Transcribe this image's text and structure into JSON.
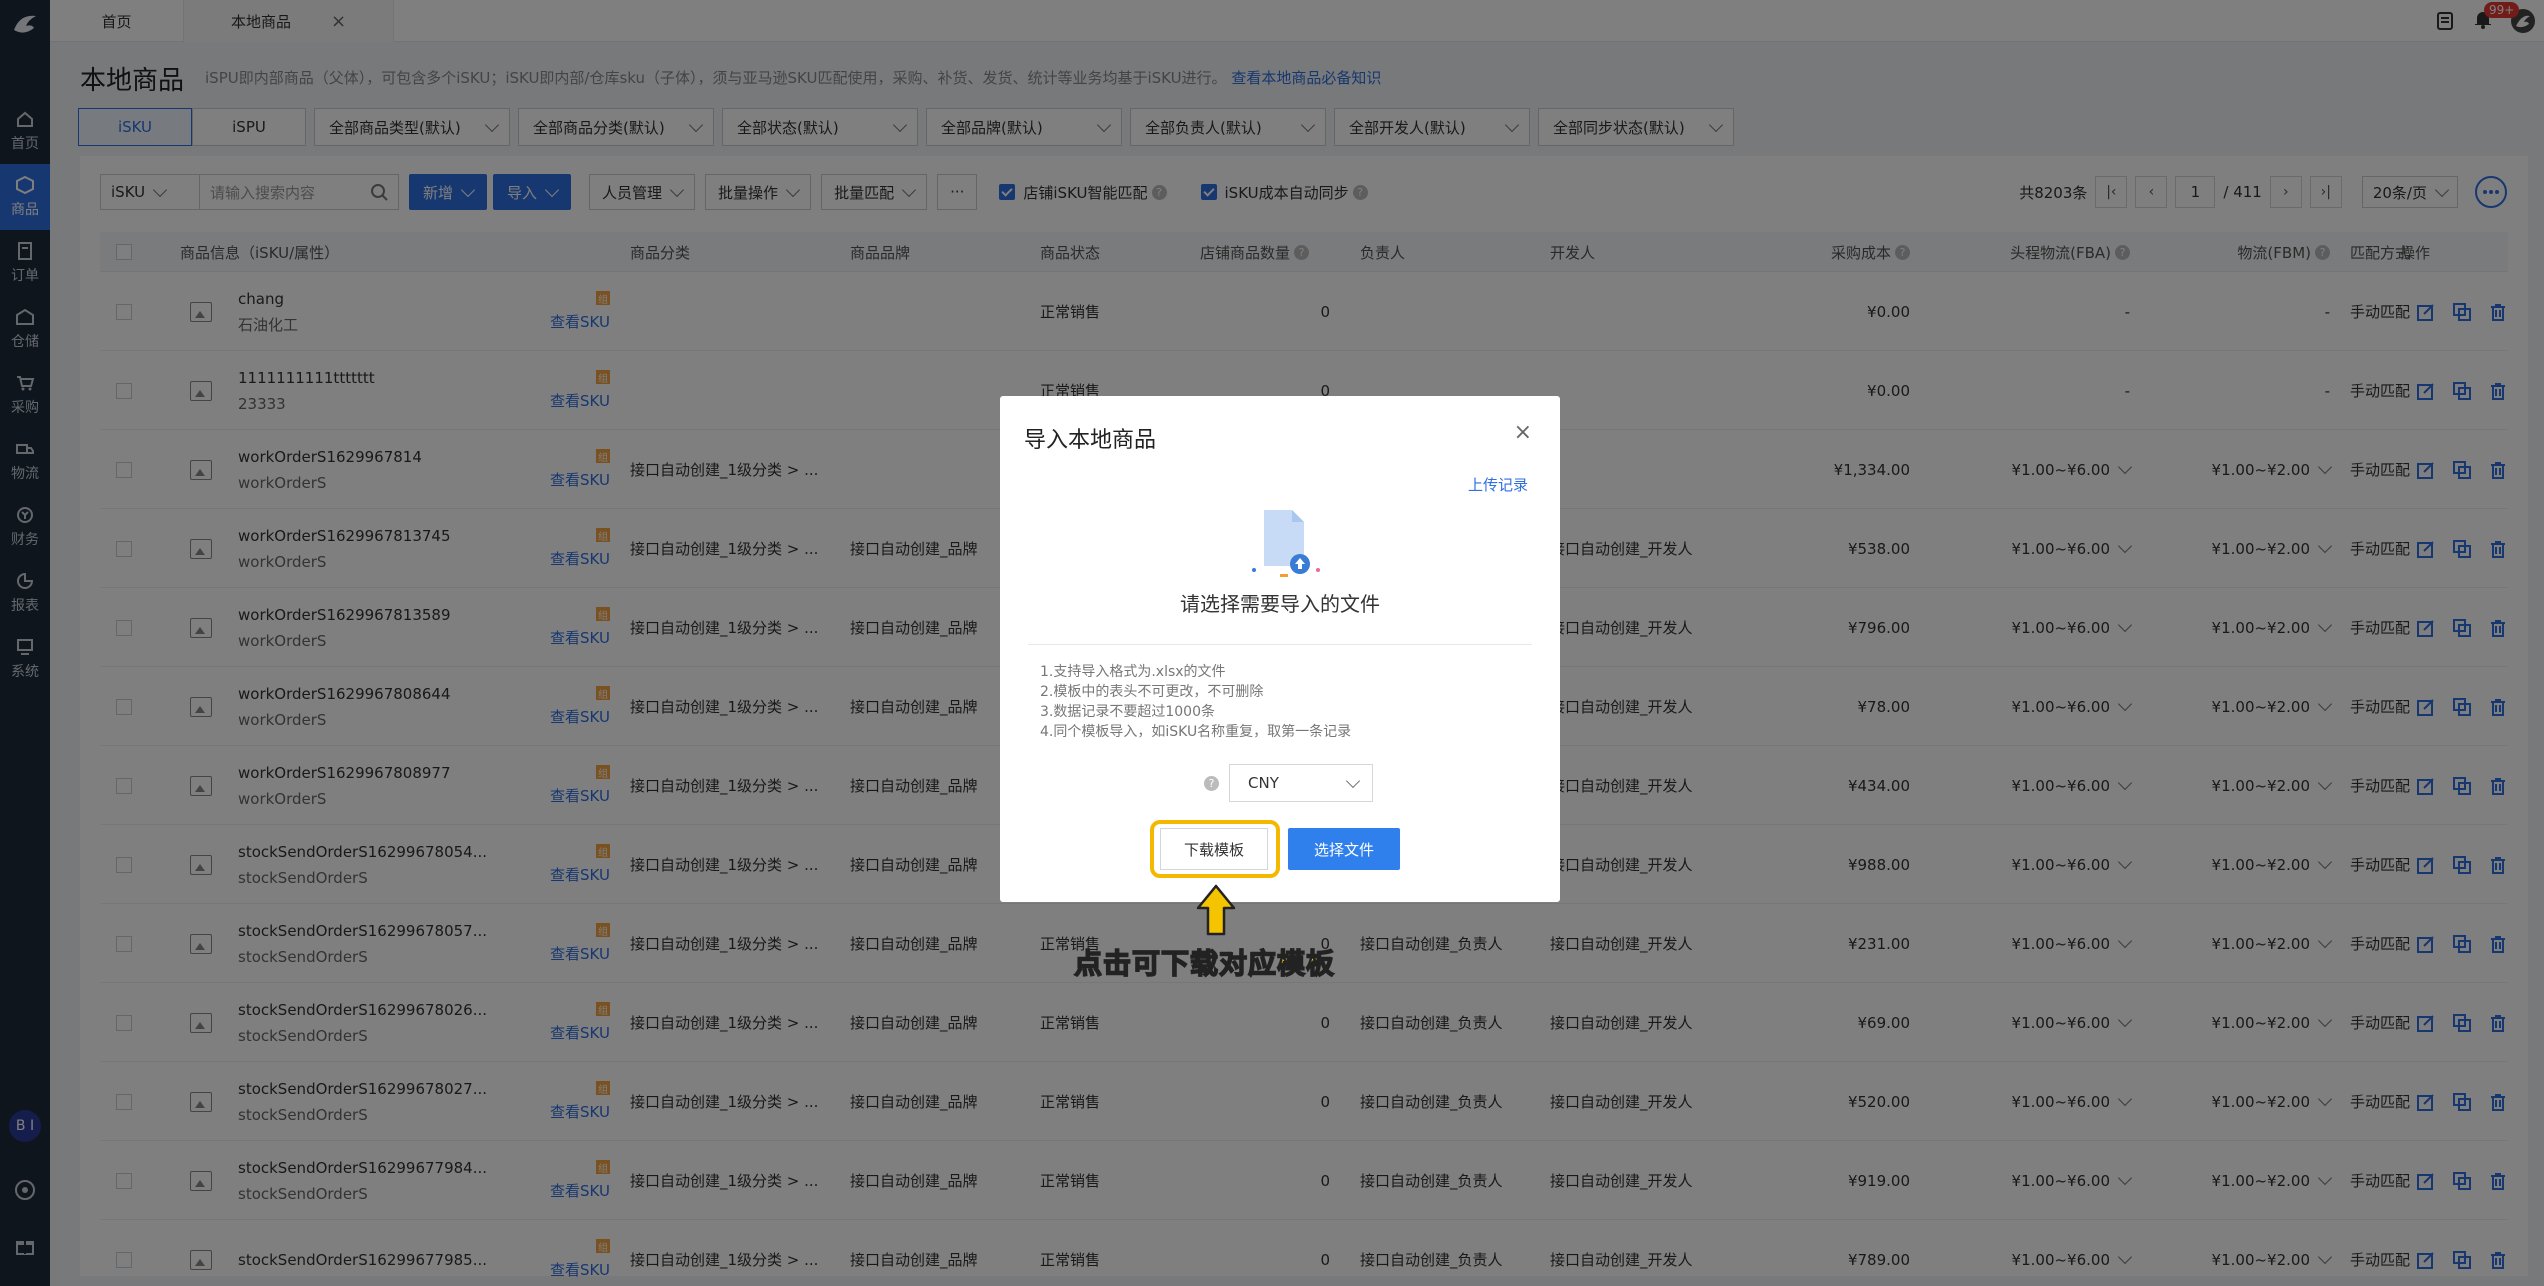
{
  "sidebar": {
    "items": [
      {
        "label": "首页",
        "icon": "home-icon"
      },
      {
        "label": "商品",
        "icon": "goods-icon",
        "active": true
      },
      {
        "label": "订单",
        "icon": "order-icon"
      },
      {
        "label": "仓储",
        "icon": "warehouse-icon"
      },
      {
        "label": "采购",
        "icon": "cart-icon"
      },
      {
        "label": "物流",
        "icon": "truck-icon"
      },
      {
        "label": "财务",
        "icon": "finance-icon"
      },
      {
        "label": "报表",
        "icon": "chart-icon"
      },
      {
        "label": "系统",
        "icon": "system-icon"
      }
    ],
    "avatar": "B I"
  },
  "tabs": {
    "home": "首页",
    "current": "本地商品",
    "close": "×"
  },
  "topbar": {
    "badge": "99+"
  },
  "header": {
    "title": "本地商品",
    "desc": "iSPU即内部商品（父体），可包含多个iSKU；iSKU即内部/仓库sku（子体），须与亚马逊SKU匹配使用，采购、补货、发货、统计等业务均基于iSKU进行。",
    "link": "查看本地商品必备知识"
  },
  "filters": {
    "seg": [
      "iSKU",
      "iSPU"
    ],
    "selects": [
      "全部商品类型(默认)",
      "全部商品分类(默认)",
      "全部状态(默认)",
      "全部品牌(默认)",
      "全部负责人(默认)",
      "全部开发人(默认)",
      "全部同步状态(默认)"
    ]
  },
  "toolbar": {
    "search_type": "iSKU",
    "search_placeholder": "请输入搜索内容",
    "add": "新增",
    "import": "导入",
    "staff": "人员管理",
    "batch": "批量操作",
    "match": "批量匹配",
    "more": "···",
    "check1": "店铺iSKU智能匹配",
    "check2": "iSKU成本自动同步",
    "total": "共8203条",
    "page": "1",
    "pages": "/ 411",
    "per_page": "20条/页"
  },
  "table": {
    "headers": [
      "商品信息（iSKU/属性）",
      "商品分类",
      "商品品牌",
      "商品状态",
      "店铺商品数量",
      "负责人",
      "开发人",
      "采购成本",
      "头程物流(FBA)",
      "物流(FBM)",
      "匹配方式",
      "操作"
    ],
    "view_sku": "查看SKU",
    "rows": [
      {
        "name": "chang",
        "sub": "石油化工",
        "cat": "",
        "brand": "",
        "status": "正常销售",
        "qty": "0",
        "owner": "",
        "dev": "",
        "cost": "¥0.00",
        "fba": "-",
        "fbm": "-",
        "match": "手动匹配"
      },
      {
        "name": "1111111111ttttttt",
        "sub": "23333",
        "cat": "",
        "brand": "",
        "status": "正常销售",
        "qty": "0",
        "owner": "",
        "dev": "",
        "cost": "¥0.00",
        "fba": "-",
        "fbm": "-",
        "match": "手动匹配"
      },
      {
        "name": "workOrderS1629967814",
        "sub": "workOrderS",
        "cat": "接口自动创建_1级分类 > ...",
        "brand": "",
        "status": "",
        "qty": "",
        "owner": "",
        "dev": "",
        "cost": "¥1,334.00",
        "fba": "¥1.00~¥6.00",
        "fbm": "¥1.00~¥2.00",
        "match": "手动匹配"
      },
      {
        "name": "workOrderS1629967813745",
        "sub": "workOrderS",
        "cat": "接口自动创建_1级分类 > ...",
        "brand": "接口自动创建_品牌",
        "status": "",
        "qty": "",
        "owner": "",
        "dev": "接口自动创建_开发人",
        "cost": "¥538.00",
        "fba": "¥1.00~¥6.00",
        "fbm": "¥1.00~¥2.00",
        "match": "手动匹配"
      },
      {
        "name": "workOrderS1629967813589",
        "sub": "workOrderS",
        "cat": "接口自动创建_1级分类 > ...",
        "brand": "接口自动创建_品牌",
        "status": "",
        "qty": "",
        "owner": "",
        "dev": "接口自动创建_开发人",
        "cost": "¥796.00",
        "fba": "¥1.00~¥6.00",
        "fbm": "¥1.00~¥2.00",
        "match": "手动匹配"
      },
      {
        "name": "workOrderS1629967808644",
        "sub": "workOrderS",
        "cat": "接口自动创建_1级分类 > ...",
        "brand": "接口自动创建_品牌",
        "status": "",
        "qty": "",
        "owner": "",
        "dev": "接口自动创建_开发人",
        "cost": "¥78.00",
        "fba": "¥1.00~¥6.00",
        "fbm": "¥1.00~¥2.00",
        "match": "手动匹配"
      },
      {
        "name": "workOrderS1629967808977",
        "sub": "workOrderS",
        "cat": "接口自动创建_1级分类 > ...",
        "brand": "接口自动创建_品牌",
        "status": "",
        "qty": "",
        "owner": "",
        "dev": "接口自动创建_开发人",
        "cost": "¥434.00",
        "fba": "¥1.00~¥6.00",
        "fbm": "¥1.00~¥2.00",
        "match": "手动匹配"
      },
      {
        "name": "stockSendOrderS16299678054...",
        "sub": "stockSendOrderS",
        "cat": "接口自动创建_1级分类 > ...",
        "brand": "接口自动创建_品牌",
        "status": "",
        "qty": "",
        "owner": "",
        "dev": "接口自动创建_开发人",
        "cost": "¥988.00",
        "fba": "¥1.00~¥6.00",
        "fbm": "¥1.00~¥2.00",
        "match": "手动匹配"
      },
      {
        "name": "stockSendOrderS16299678057...",
        "sub": "stockSendOrderS",
        "cat": "接口自动创建_1级分类 > ...",
        "brand": "接口自动创建_品牌",
        "status": "正常销售",
        "qty": "0",
        "owner": "接口自动创建_负责人",
        "dev": "接口自动创建_开发人",
        "cost": "¥231.00",
        "fba": "¥1.00~¥6.00",
        "fbm": "¥1.00~¥2.00",
        "match": "手动匹配"
      },
      {
        "name": "stockSendOrderS16299678026...",
        "sub": "stockSendOrderS",
        "cat": "接口自动创建_1级分类 > ...",
        "brand": "接口自动创建_品牌",
        "status": "正常销售",
        "qty": "0",
        "owner": "接口自动创建_负责人",
        "dev": "接口自动创建_开发人",
        "cost": "¥69.00",
        "fba": "¥1.00~¥6.00",
        "fbm": "¥1.00~¥2.00",
        "match": "手动匹配"
      },
      {
        "name": "stockSendOrderS16299678027...",
        "sub": "stockSendOrderS",
        "cat": "接口自动创建_1级分类 > ...",
        "brand": "接口自动创建_品牌",
        "status": "正常销售",
        "qty": "0",
        "owner": "接口自动创建_负责人",
        "dev": "接口自动创建_开发人",
        "cost": "¥520.00",
        "fba": "¥1.00~¥6.00",
        "fbm": "¥1.00~¥2.00",
        "match": "手动匹配"
      },
      {
        "name": "stockSendOrderS16299677984...",
        "sub": "stockSendOrderS",
        "cat": "接口自动创建_1级分类 > ...",
        "brand": "接口自动创建_品牌",
        "status": "正常销售",
        "qty": "0",
        "owner": "接口自动创建_负责人",
        "dev": "接口自动创建_开发人",
        "cost": "¥919.00",
        "fba": "¥1.00~¥6.00",
        "fbm": "¥1.00~¥2.00",
        "match": "手动匹配"
      },
      {
        "name": "stockSendOrderS16299677985...",
        "sub": "",
        "cat": "接口自动创建_1级分类 > ...",
        "brand": "接口自动创建_品牌",
        "status": "正常销售",
        "qty": "0",
        "owner": "接口自动创建_负责人",
        "dev": "接口自动创建_开发人",
        "cost": "¥789.00",
        "fba": "¥1.00~¥6.00",
        "fbm": "¥1.00~¥2.00",
        "match": "手动匹配"
      }
    ]
  },
  "modal": {
    "title": "导入本地商品",
    "close": "×",
    "upload_log": "上传记录",
    "subtitle": "请选择需要导入的文件",
    "notes": [
      "1.支持导入格式为.xlsx的文件",
      "2.模板中的表头不可更改，不可删除",
      "3.数据记录不要超过1000条",
      "4.同个模板导入，如iSKU名称重复，取第一条记录"
    ],
    "currency": "CNY",
    "download": "下载模板",
    "choose": "选择文件"
  },
  "annotation": "点击可下载对应模板",
  "colors": {
    "primary": "#2f6fe0",
    "highlight": "#f5b800",
    "sidebar": "#1e2a3a"
  }
}
